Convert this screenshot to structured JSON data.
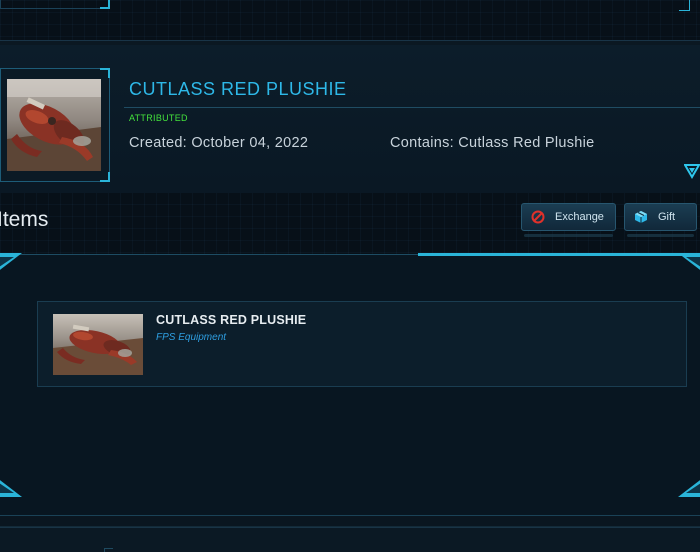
{
  "pledge": {
    "title": "CUTLASS RED PLUSHIE",
    "status": "ATTRIBUTED",
    "created": "Created: October 04, 2022",
    "contains": "Contains: Cutlass Red Plushie",
    "status_color": "#44e23c",
    "title_color": "#2eb8e8"
  },
  "items_section": {
    "heading": "Items",
    "actions": [
      {
        "label": "Exchange",
        "icon": "prohibited-icon",
        "icon_color": "#e0312b"
      },
      {
        "label": "Gift",
        "icon": "gift-box-icon",
        "icon_color": "#2eb8e8"
      }
    ],
    "items": [
      {
        "name": "CUTLASS RED PLUSHIE",
        "type": "FPS Equipment"
      }
    ]
  },
  "icons": {
    "expand": "chevron-down-icon"
  },
  "colors": {
    "accent": "#2ab4d8",
    "background": "#071018",
    "item_type": "#2e9ee0"
  }
}
